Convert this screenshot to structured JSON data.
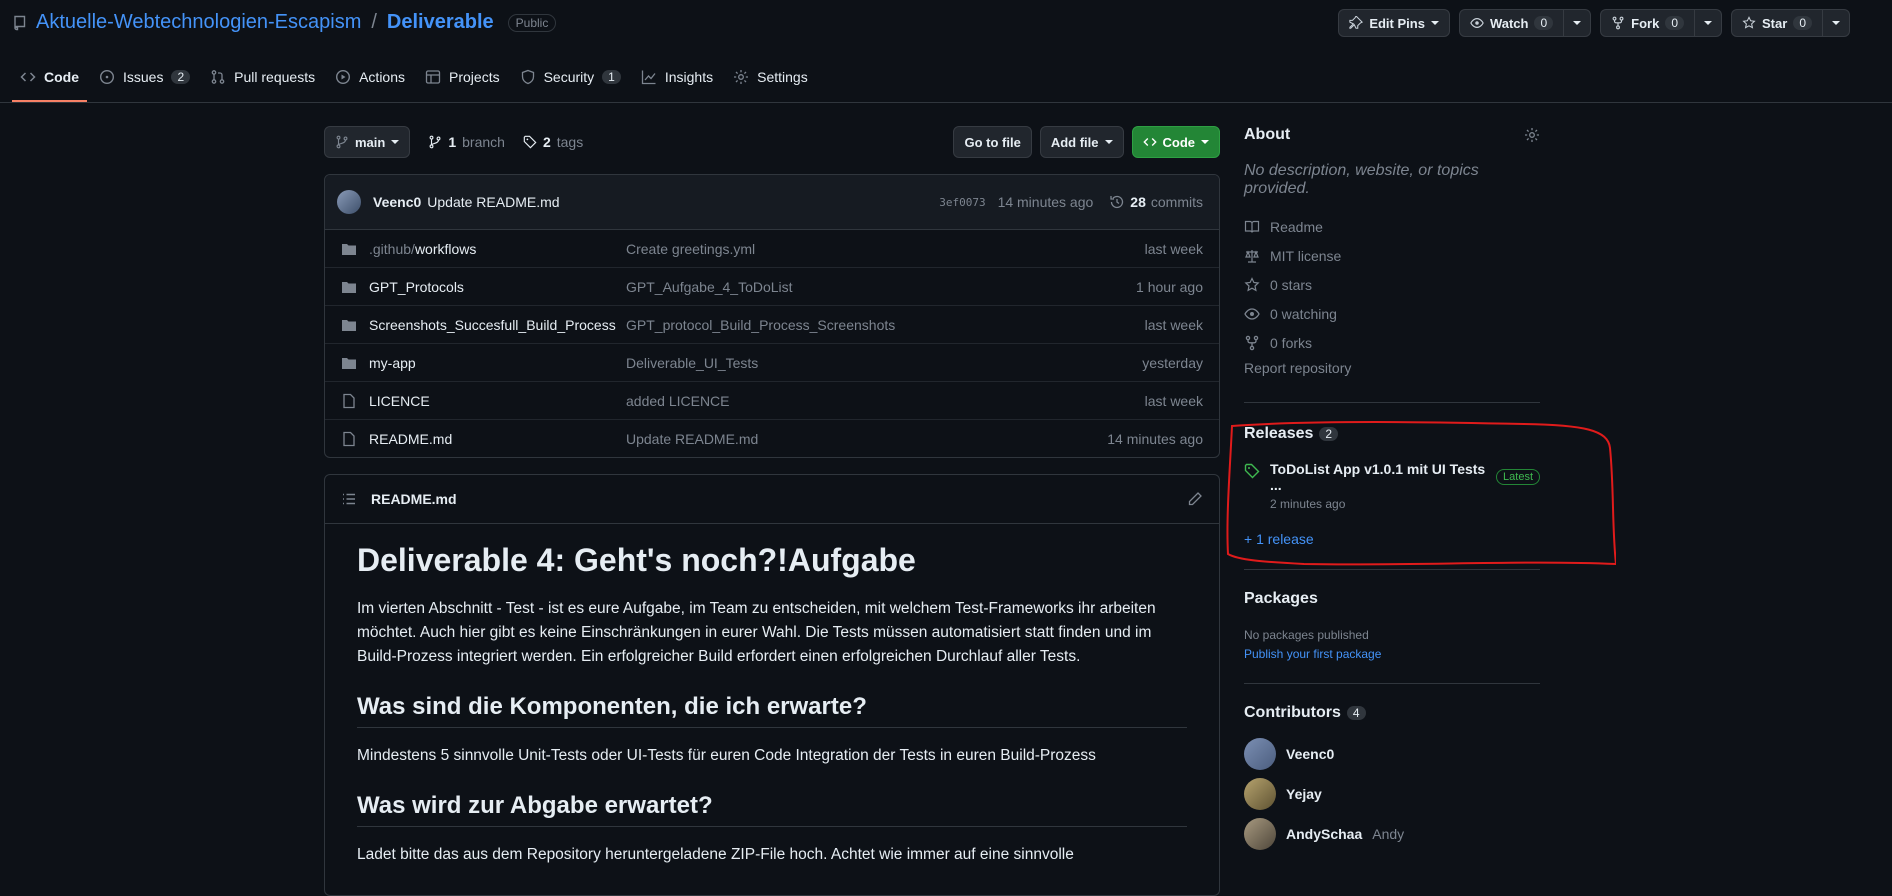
{
  "repo": {
    "owner": "Aktuelle-Webtechnologien-Escapism",
    "separator": "/",
    "name": "Deliverable",
    "visibility": "Public"
  },
  "actions": {
    "edit_pins": "Edit Pins",
    "watch": "Watch",
    "watch_count": "0",
    "fork": "Fork",
    "fork_count": "0",
    "star": "Star",
    "star_count": "0"
  },
  "tabs": [
    {
      "label": "Code",
      "icon": "code-icon"
    },
    {
      "label": "Issues",
      "count": "2",
      "icon": "issue-icon"
    },
    {
      "label": "Pull requests",
      "icon": "pull-request-icon"
    },
    {
      "label": "Actions",
      "icon": "play-icon"
    },
    {
      "label": "Projects",
      "icon": "table-icon"
    },
    {
      "label": "Security",
      "count": "1",
      "icon": "shield-icon"
    },
    {
      "label": "Insights",
      "icon": "graph-icon"
    },
    {
      "label": "Settings",
      "icon": "gear-icon"
    }
  ],
  "file_nav": {
    "branch": "main",
    "branch_count": "1",
    "branch_label": "branch",
    "tag_count": "2",
    "tag_label": "tags",
    "go_to_file": "Go to file",
    "add_file": "Add file",
    "code": "Code"
  },
  "latest_commit": {
    "author": "Veenc0",
    "message": "Update README.md",
    "sha": "3ef0073",
    "time": "14 minutes ago",
    "commit_count": "28",
    "commit_label": "commits"
  },
  "files": [
    {
      "prefix": ".github/",
      "name": "workflows",
      "message": "Create greetings.yml",
      "age": "last week",
      "type": "folder"
    },
    {
      "prefix": "",
      "name": "GPT_Protocols",
      "message": "GPT_Aufgabe_4_ToDoList",
      "age": "1 hour ago",
      "type": "folder"
    },
    {
      "prefix": "",
      "name": "Screenshots_Succesfull_Build_Process",
      "message": "GPT_protocol_Build_Process_Screenshots",
      "age": "last week",
      "type": "folder"
    },
    {
      "prefix": "",
      "name": "my-app",
      "message": "Deliverable_UI_Tests",
      "age": "yesterday",
      "type": "folder"
    },
    {
      "prefix": "",
      "name": "LICENCE",
      "message": "added LICENCE",
      "age": "last week",
      "type": "file"
    },
    {
      "prefix": "",
      "name": "README.md",
      "message": "Update README.md",
      "age": "14 minutes ago",
      "type": "file"
    }
  ],
  "readme": {
    "filename": "README.md",
    "h1": "Deliverable 4: Geht's noch?!Aufgabe",
    "p1": "Im vierten Abschnitt - Test - ist es eure Aufgabe, im Team zu entscheiden, mit welchem Test-Frameworks ihr arbeiten möchtet. Auch hier gibt es keine Einschränkungen in eurer Wahl. Die Tests müssen automatisiert statt finden und im Build-Prozess integriert werden. Ein erfolgreicher Build erfordert einen erfolgreichen Durchlauf aller Tests.",
    "h2a": "Was sind die Komponenten, die ich erwarte?",
    "p2": "Mindestens 5 sinnvolle Unit-Tests oder UI-Tests für euren Code Integration der Tests in euren Build-Prozess",
    "h2b": "Was wird zur Abgabe erwartet?",
    "p3": "Ladet bitte das aus dem Repository heruntergeladene ZIP-File hoch. Achtet wie immer auf eine sinnvolle"
  },
  "about": {
    "title": "About",
    "description": "No description, website, or topics provided.",
    "items": [
      {
        "label": "Readme",
        "icon": "book-icon"
      },
      {
        "label": "MIT license",
        "icon": "law-icon"
      },
      {
        "label": "0 stars",
        "icon": "star-icon"
      },
      {
        "label": "0 watching",
        "icon": "eye-icon"
      },
      {
        "label": "0 forks",
        "icon": "fork-icon"
      }
    ],
    "report": "Report repository"
  },
  "releases": {
    "title": "Releases",
    "count": "2",
    "latest_title": "ToDoList App v1.0.1 mit UI Tests ...",
    "latest_badge": "Latest",
    "latest_date": "2 minutes ago",
    "more": "+ 1 release"
  },
  "packages": {
    "title": "Packages",
    "none": "No packages published",
    "publish": "Publish your first package"
  },
  "contributors": {
    "title": "Contributors",
    "count": "4",
    "list": [
      {
        "login": "Veenc0",
        "name": ""
      },
      {
        "login": "Yejay",
        "name": ""
      },
      {
        "login": "AndySchaa",
        "name": "Andy"
      }
    ]
  },
  "colors": {
    "background": "#0d1117",
    "accent_link": "#4493f8",
    "code_button": "#238636",
    "tab_underline": "#f78166",
    "annotation": "#e01b1b"
  }
}
